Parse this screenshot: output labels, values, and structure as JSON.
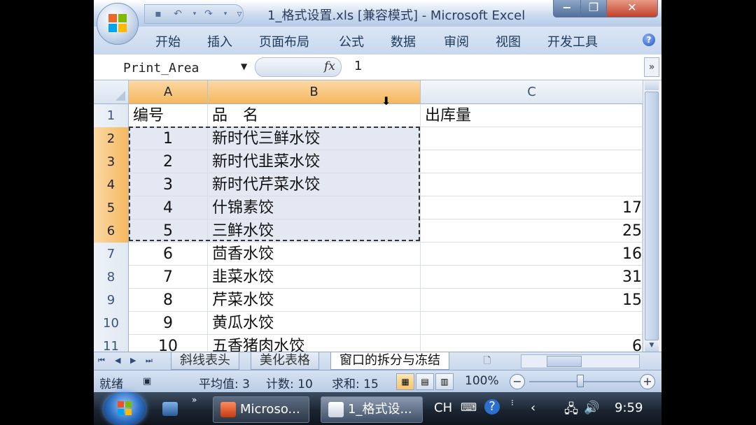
{
  "window": {
    "title": "1_格式设置.xls  [兼容模式] - Microsoft Excel",
    "controls": {
      "minimize": "−",
      "maximize": "❐",
      "close": "✕"
    }
  },
  "quick_access": {
    "save": "▪",
    "undo": "↶",
    "redo": "↷",
    "customize": "▿"
  },
  "ribbon": {
    "tabs": [
      "开始",
      "插入",
      "页面布局",
      "公式",
      "数据",
      "审阅",
      "视图",
      "开发工具"
    ],
    "help": "?"
  },
  "formula_bar": {
    "name_box": "Print_Area",
    "fx": "fx",
    "formula": "1"
  },
  "sheet": {
    "columns": [
      "A",
      "B",
      "C"
    ],
    "selected_columns": [
      "A",
      "B"
    ],
    "rows": [
      {
        "num": "1",
        "a": "编号",
        "b": "品　名",
        "c": "出库量"
      },
      {
        "num": "2",
        "a": "1",
        "b": "新时代三鲜水饺",
        "c": ""
      },
      {
        "num": "3",
        "a": "2",
        "b": "新时代韭菜水饺",
        "c": ""
      },
      {
        "num": "4",
        "a": "3",
        "b": "新时代芹菜水饺",
        "c": ""
      },
      {
        "num": "5",
        "a": "4",
        "b": "什锦素饺",
        "c": "17"
      },
      {
        "num": "6",
        "a": "5",
        "b": "三鲜水饺",
        "c": "25"
      },
      {
        "num": "7",
        "a": "6",
        "b": "茴香水饺",
        "c": "16"
      },
      {
        "num": "8",
        "a": "7",
        "b": "韭菜水饺",
        "c": "31"
      },
      {
        "num": "9",
        "a": "8",
        "b": "芹菜水饺",
        "c": "15"
      },
      {
        "num": "10",
        "a": "9",
        "b": "黄瓜水饺",
        "c": ""
      },
      {
        "num": "11",
        "a": "10",
        "b": "五香猪肉水饺",
        "c": "6"
      }
    ]
  },
  "sheet_tabs": [
    "斜线表头",
    "美化表格",
    "窗口的拆分与冻结"
  ],
  "status": {
    "mode": "就绪",
    "average": "平均值: 3",
    "count": "计数: 10",
    "sum": "求和: 15",
    "zoom": "100%",
    "zoom_out": "−",
    "zoom_in": "+"
  },
  "taskbar": {
    "tasks": [
      "Microso...",
      "1_格式设..."
    ],
    "lang": "CH",
    "help": "?",
    "time": "9:59"
  },
  "colors": {
    "selected_header": "#f5b85e",
    "selection_fill": "#e4e8f2",
    "ribbon_text": "#1e395b"
  }
}
